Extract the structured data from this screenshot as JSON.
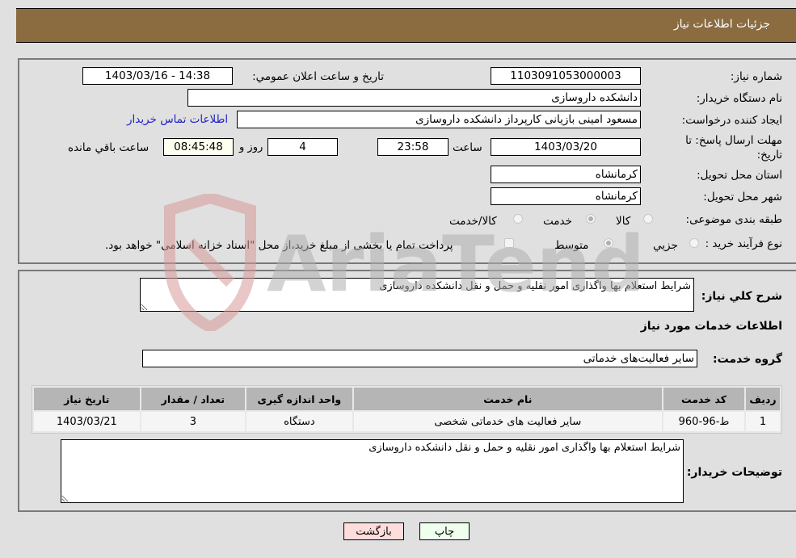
{
  "header": {
    "title": "جزئيات اطلاعات نياز"
  },
  "need_info": {
    "need_number_label": "شماره نیاز:",
    "need_number": "1103091053000003",
    "announce_label": "تاريخ و ساعت اعلان عمومي:",
    "announce_value": "1403/03/16 - 14:38",
    "buyer_org_label": "نام دستگاه خریدار:",
    "buyer_org": "دانشکده داروسازی",
    "buyer_org_extra": "",
    "creator_label": "ایجاد کننده درخواست:",
    "creator": "مسعود امینی بازیانی کارپرداز دانشکده داروسازی",
    "contact_link": "اطلاعات تماس خریدار",
    "deadline_label": "مهلت ارسال پاسخ: تا تاریخ:",
    "deadline_date": "1403/03/20",
    "time_label": "ساعت",
    "deadline_time": "23:58",
    "days_value": "4",
    "days_suffix": "روز و",
    "remaining_time": "08:45:48",
    "remaining_suffix": "ساعت باقي مانده",
    "province_label": "استان محل تحویل:",
    "province": "کرمانشاه",
    "city_label": "شهر محل تحویل:",
    "city": "کرمانشاه",
    "category_label": "طبقه بندی موضوعی:",
    "category_options": [
      {
        "label": "کالا",
        "checked": false
      },
      {
        "label": "خدمت",
        "checked": true
      },
      {
        "label": "کالا/خدمت",
        "checked": false
      }
    ],
    "process_label": "نوع فرآیند خرید :",
    "process_options": [
      {
        "label": "جزيي",
        "checked": false
      },
      {
        "label": "متوسط",
        "checked": true
      }
    ],
    "treasury_note": "پرداخت تمام یا بخشی از مبلغ خرید،از محل \"اسناد خزانه اسلامی\" خواهد بود."
  },
  "details": {
    "general_desc_label": "شرح كلي نياز:",
    "general_desc": "شرایط استعلام بها واگذاری امور نقلیه و حمل و نقل دانشکده داروسازی",
    "services_title": "اطلاعات خدمات مورد نیاز",
    "service_group_label": "گروه خدمت:",
    "service_group": "سایر فعالیت‌های خدماتی",
    "table": {
      "headers": [
        "ردیف",
        "کد خدمت",
        "نام خدمت",
        "واحد اندازه گیری",
        "تعداد / مقدار",
        "تاریخ نیاز"
      ],
      "rows": [
        [
          "1",
          "ط-96-960",
          "سایر فعالیت های خدماتی شخصی",
          "دستگاه",
          "3",
          "1403/03/21"
        ]
      ]
    },
    "buyer_notes_label": "توضیحات خریدار:",
    "buyer_notes": "شرایط استعلام بها واگذاری امور نقلیه و حمل و نقل دانشکده داروسازی"
  },
  "buttons": {
    "print": "چاپ",
    "back": "بازگشت"
  },
  "watermark": {
    "text": "AriaTender.neT"
  },
  "colors": {
    "header_bg": "#8b6b40",
    "link": "#2222cc",
    "back_btn": "#ffdddd",
    "print_btn": "#eeffee"
  }
}
